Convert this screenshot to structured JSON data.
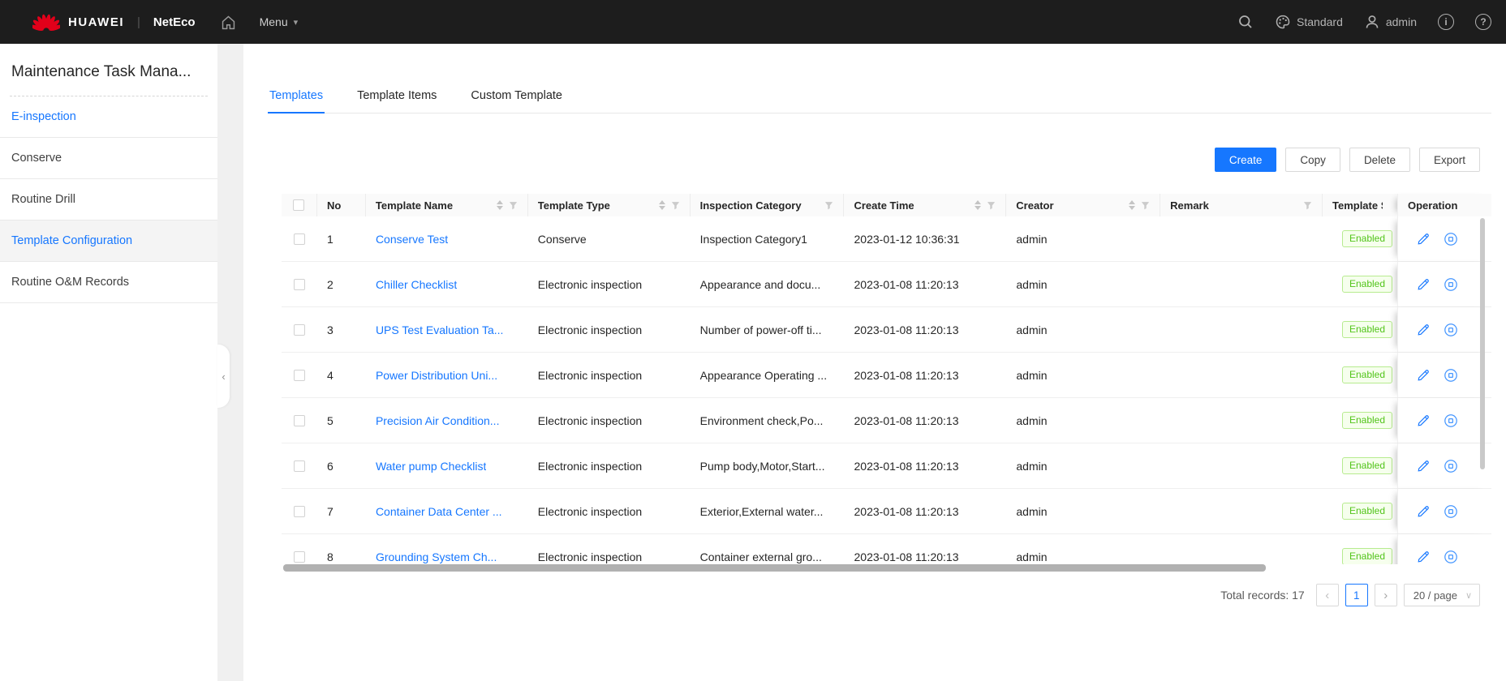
{
  "colors": {
    "accent": "#1677ff",
    "topbar_bg": "#1d1d1d",
    "status_text": "#52c41a",
    "status_bg": "#f6ffed",
    "status_border": "#b7eb8f"
  },
  "topbar": {
    "brand": "HUAWEI",
    "product": "NetEco",
    "menu_label": "Menu",
    "theme_label": "Standard",
    "user_label": "admin"
  },
  "icons": {
    "menu_caret": "▾",
    "collapse_chevron": "‹",
    "info_glyph": "i",
    "help_glyph": "?",
    "prev_glyph": "‹",
    "next_glyph": "›",
    "select_caret": "∨"
  },
  "sidebar": {
    "title": "Maintenance Task Mana...",
    "items": [
      {
        "label": "E-inspection",
        "highlight": true,
        "active": false
      },
      {
        "label": "Conserve",
        "highlight": false,
        "active": false
      },
      {
        "label": "Routine Drill",
        "highlight": false,
        "active": false
      },
      {
        "label": "Template Configuration",
        "highlight": true,
        "active": true
      },
      {
        "label": "Routine O&M Records",
        "highlight": false,
        "active": false
      }
    ]
  },
  "tabs": [
    {
      "label": "Templates",
      "active": true
    },
    {
      "label": "Template Items",
      "active": false
    },
    {
      "label": "Custom Template",
      "active": false
    }
  ],
  "toolbar": {
    "create_label": "Create",
    "copy_label": "Copy",
    "delete_label": "Delete",
    "export_label": "Export"
  },
  "table": {
    "columns": [
      {
        "key": "no",
        "label": "No",
        "sort": false,
        "filter": false
      },
      {
        "key": "name",
        "label": "Template Name",
        "sort": true,
        "filter": true
      },
      {
        "key": "type",
        "label": "Template Type",
        "sort": true,
        "filter": true
      },
      {
        "key": "category",
        "label": "Inspection Category",
        "sort": false,
        "filter": true
      },
      {
        "key": "time",
        "label": "Create Time",
        "sort": true,
        "filter": true
      },
      {
        "key": "creator",
        "label": "Creator",
        "sort": true,
        "filter": true
      },
      {
        "key": "remark",
        "label": "Remark",
        "sort": false,
        "filter": true
      },
      {
        "key": "status",
        "label": "Template S",
        "sort": false,
        "filter": false
      },
      {
        "key": "operation",
        "label": "Operation",
        "sort": false,
        "filter": false
      }
    ],
    "rows": [
      {
        "no": "1",
        "name": "Conserve Test",
        "type": "Conserve",
        "category": "Inspection Category1",
        "time": "2023-01-12 10:36:31",
        "creator": "admin",
        "remark": "",
        "status": "Enabled"
      },
      {
        "no": "2",
        "name": "Chiller Checklist",
        "type": "Electronic inspection",
        "category": "Appearance and docu...",
        "time": "2023-01-08 11:20:13",
        "creator": "admin",
        "remark": "",
        "status": "Enabled"
      },
      {
        "no": "3",
        "name": "UPS Test Evaluation Ta...",
        "type": "Electronic inspection",
        "category": "Number of power-off ti...",
        "time": "2023-01-08 11:20:13",
        "creator": "admin",
        "remark": "",
        "status": "Enabled"
      },
      {
        "no": "4",
        "name": "Power Distribution Uni...",
        "type": "Electronic inspection",
        "category": "Appearance Operating ...",
        "time": "2023-01-08 11:20:13",
        "creator": "admin",
        "remark": "",
        "status": "Enabled"
      },
      {
        "no": "5",
        "name": "Precision Air Condition...",
        "type": "Electronic inspection",
        "category": "Environment check,Po...",
        "time": "2023-01-08 11:20:13",
        "creator": "admin",
        "remark": "",
        "status": "Enabled"
      },
      {
        "no": "6",
        "name": "Water pump Checklist",
        "type": "Electronic inspection",
        "category": "Pump body,Motor,Start...",
        "time": "2023-01-08 11:20:13",
        "creator": "admin",
        "remark": "",
        "status": "Enabled"
      },
      {
        "no": "7",
        "name": "Container Data Center ...",
        "type": "Electronic inspection",
        "category": "Exterior,External water...",
        "time": "2023-01-08 11:20:13",
        "creator": "admin",
        "remark": "",
        "status": "Enabled"
      },
      {
        "no": "8",
        "name": "Grounding System  Ch...",
        "type": "Electronic inspection",
        "category": "Container external gro...",
        "time": "2023-01-08 11:20:13",
        "creator": "admin",
        "remark": "",
        "status": "Enabled"
      }
    ]
  },
  "pagination": {
    "total_label": "Total records: 17",
    "current_page": "1",
    "page_size": "20 / page"
  }
}
